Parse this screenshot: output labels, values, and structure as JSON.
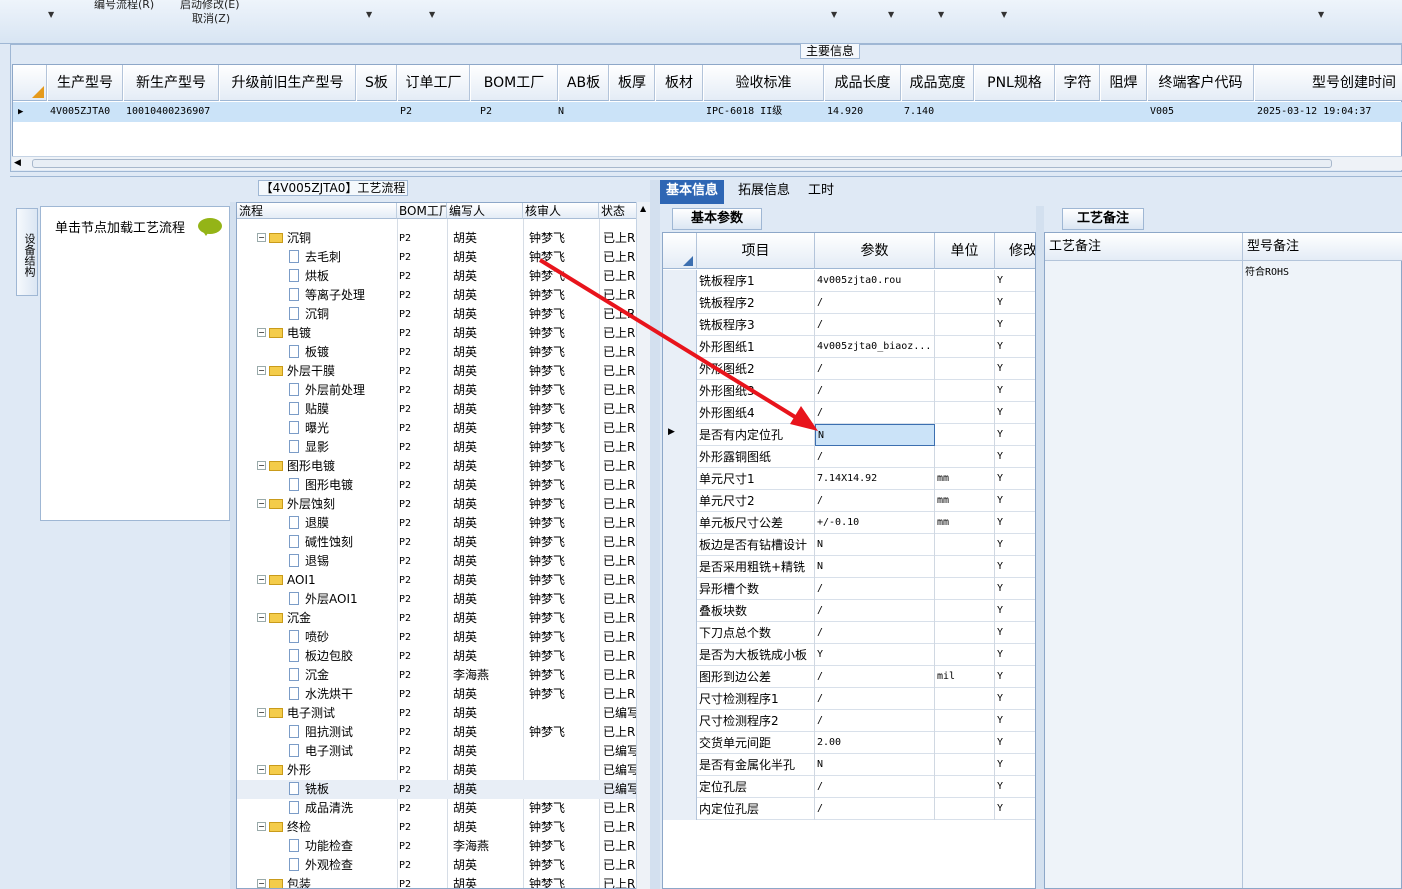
{
  "ribbon": {
    "items": [
      "编号流程(R)",
      "启动修改(E)",
      "取消(Z)"
    ]
  },
  "main_info": {
    "title": "主要信息",
    "columns": [
      "生产型号",
      "新生产型号",
      "升级前旧生产型号",
      "S板",
      "订单工厂",
      "BOM工厂",
      "AB板",
      "板厚",
      "板材",
      "验收标准",
      "成品长度",
      "成品宽度",
      "PNL规格",
      "字符",
      "阻焊",
      "终端客户代码",
      "型号创建时间"
    ],
    "row": [
      "4V005ZJTA0",
      "10010400236907",
      "",
      "",
      "P2",
      "P2",
      "N",
      "",
      "",
      "IPC-6018 II级",
      "14.920",
      "7.140",
      "",
      "",
      "",
      "V005",
      "2025-03-12 19:04:37"
    ]
  },
  "left_panel": {
    "side_tab": "设备结构",
    "load_label": "单击节点加载工艺流程"
  },
  "tree": {
    "title": "【4V005ZJTA0】工艺流程",
    "columns": [
      "流程",
      "BOM工厂",
      "编写人",
      "核审人",
      "状态"
    ],
    "rows": [
      {
        "name": "沉铜",
        "folder": true,
        "bom": "P2",
        "writer": "胡英",
        "reviewer": "钟梦飞",
        "status": "已上R"
      },
      {
        "name": "去毛刺",
        "folder": false,
        "bom": "P2",
        "writer": "胡英",
        "reviewer": "钟梦飞",
        "status": "已上R"
      },
      {
        "name": "烘板",
        "folder": false,
        "bom": "P2",
        "writer": "胡英",
        "reviewer": "钟梦飞",
        "status": "已上R"
      },
      {
        "name": "等离子处理",
        "folder": false,
        "bom": "P2",
        "writer": "胡英",
        "reviewer": "钟梦飞",
        "status": "已上R"
      },
      {
        "name": "沉铜",
        "folder": false,
        "bom": "P2",
        "writer": "胡英",
        "reviewer": "钟梦飞",
        "status": "已上R"
      },
      {
        "name": "电镀",
        "folder": true,
        "bom": "P2",
        "writer": "胡英",
        "reviewer": "钟梦飞",
        "status": "已上R"
      },
      {
        "name": "板镀",
        "folder": false,
        "bom": "P2",
        "writer": "胡英",
        "reviewer": "钟梦飞",
        "status": "已上R"
      },
      {
        "name": "外层干膜",
        "folder": true,
        "bom": "P2",
        "writer": "胡英",
        "reviewer": "钟梦飞",
        "status": "已上R"
      },
      {
        "name": "外层前处理",
        "folder": false,
        "bom": "P2",
        "writer": "胡英",
        "reviewer": "钟梦飞",
        "status": "已上R"
      },
      {
        "name": "贴膜",
        "folder": false,
        "bom": "P2",
        "writer": "胡英",
        "reviewer": "钟梦飞",
        "status": "已上R"
      },
      {
        "name": "曝光",
        "folder": false,
        "bom": "P2",
        "writer": "胡英",
        "reviewer": "钟梦飞",
        "status": "已上R"
      },
      {
        "name": "显影",
        "folder": false,
        "bom": "P2",
        "writer": "胡英",
        "reviewer": "钟梦飞",
        "status": "已上R"
      },
      {
        "name": "图形电镀",
        "folder": true,
        "bom": "P2",
        "writer": "胡英",
        "reviewer": "钟梦飞",
        "status": "已上R"
      },
      {
        "name": "图形电镀",
        "folder": false,
        "bom": "P2",
        "writer": "胡英",
        "reviewer": "钟梦飞",
        "status": "已上R"
      },
      {
        "name": "外层蚀刻",
        "folder": true,
        "bom": "P2",
        "writer": "胡英",
        "reviewer": "钟梦飞",
        "status": "已上R"
      },
      {
        "name": "退膜",
        "folder": false,
        "bom": "P2",
        "writer": "胡英",
        "reviewer": "钟梦飞",
        "status": "已上R"
      },
      {
        "name": "碱性蚀刻",
        "folder": false,
        "bom": "P2",
        "writer": "胡英",
        "reviewer": "钟梦飞",
        "status": "已上R"
      },
      {
        "name": "退锡",
        "folder": false,
        "bom": "P2",
        "writer": "胡英",
        "reviewer": "钟梦飞",
        "status": "已上R"
      },
      {
        "name": "AOI1",
        "folder": true,
        "bom": "P2",
        "writer": "胡英",
        "reviewer": "钟梦飞",
        "status": "已上R"
      },
      {
        "name": "外层AOI1",
        "folder": false,
        "bom": "P2",
        "writer": "胡英",
        "reviewer": "钟梦飞",
        "status": "已上R"
      },
      {
        "name": "沉金",
        "folder": true,
        "bom": "P2",
        "writer": "胡英",
        "reviewer": "钟梦飞",
        "status": "已上R"
      },
      {
        "name": "喷砂",
        "folder": false,
        "bom": "P2",
        "writer": "胡英",
        "reviewer": "钟梦飞",
        "status": "已上R"
      },
      {
        "name": "板边包胶",
        "folder": false,
        "bom": "P2",
        "writer": "胡英",
        "reviewer": "钟梦飞",
        "status": "已上R"
      },
      {
        "name": "沉金",
        "folder": false,
        "bom": "P2",
        "writer": "李海燕",
        "reviewer": "钟梦飞",
        "status": "已上R"
      },
      {
        "name": "水洗烘干",
        "folder": false,
        "bom": "P2",
        "writer": "胡英",
        "reviewer": "钟梦飞",
        "status": "已上R"
      },
      {
        "name": "电子测试",
        "folder": true,
        "bom": "P2",
        "writer": "胡英",
        "reviewer": "",
        "status": "已编写"
      },
      {
        "name": "阻抗测试",
        "folder": false,
        "bom": "P2",
        "writer": "胡英",
        "reviewer": "钟梦飞",
        "status": "已上R"
      },
      {
        "name": "电子测试",
        "folder": false,
        "bom": "P2",
        "writer": "胡英",
        "reviewer": "",
        "status": "已编写"
      },
      {
        "name": "外形",
        "folder": true,
        "bom": "P2",
        "writer": "胡英",
        "reviewer": "",
        "status": "已编写"
      },
      {
        "name": "铣板",
        "folder": false,
        "bom": "P2",
        "writer": "胡英",
        "reviewer": "",
        "status": "已编写"
      },
      {
        "name": "成品清洗",
        "folder": false,
        "bom": "P2",
        "writer": "胡英",
        "reviewer": "钟梦飞",
        "status": "已上R"
      },
      {
        "name": "终检",
        "folder": true,
        "bom": "P2",
        "writer": "胡英",
        "reviewer": "钟梦飞",
        "status": "已上R"
      },
      {
        "name": "功能检查",
        "folder": false,
        "bom": "P2",
        "writer": "李海燕",
        "reviewer": "钟梦飞",
        "status": "已上R"
      },
      {
        "name": "外观检查",
        "folder": false,
        "bom": "P2",
        "writer": "胡英",
        "reviewer": "钟梦飞",
        "status": "已上R"
      },
      {
        "name": "包装",
        "folder": true,
        "bom": "P2",
        "writer": "胡英",
        "reviewer": "钟梦飞",
        "status": "已上R"
      }
    ]
  },
  "right_tabs": [
    "基本信息",
    "拓展信息",
    "工时"
  ],
  "basic": {
    "tab": "基本参数",
    "columns": [
      "项目",
      "参数",
      "单位",
      "修改"
    ],
    "rows": [
      {
        "item": "铣板程序1",
        "value": "4v005zjta0.rou",
        "unit": "",
        "mod": "Y"
      },
      {
        "item": "铣板程序2",
        "value": "/",
        "unit": "",
        "mod": "Y"
      },
      {
        "item": "铣板程序3",
        "value": "/",
        "unit": "",
        "mod": "Y"
      },
      {
        "item": "外形图纸1",
        "value": "4v005zjta0_biaoz...",
        "unit": "",
        "mod": "Y"
      },
      {
        "item": "外形图纸2",
        "value": "/",
        "unit": "",
        "mod": "Y"
      },
      {
        "item": "外形图纸3",
        "value": "/",
        "unit": "",
        "mod": "Y"
      },
      {
        "item": "外形图纸4",
        "value": "/",
        "unit": "",
        "mod": "Y"
      },
      {
        "item": "是否有内定位孔",
        "value": "N",
        "unit": "",
        "mod": "Y"
      },
      {
        "item": "外形露铜图纸",
        "value": "/",
        "unit": "",
        "mod": "Y"
      },
      {
        "item": "单元尺寸1",
        "value": "7.14X14.92",
        "unit": "mm",
        "mod": "Y"
      },
      {
        "item": "单元尺寸2",
        "value": "/",
        "unit": "mm",
        "mod": "Y"
      },
      {
        "item": "单元板尺寸公差",
        "value": "+/-0.10",
        "unit": "mm",
        "mod": "Y"
      },
      {
        "item": "板边是否有钻槽设计",
        "value": "N",
        "unit": "",
        "mod": "Y"
      },
      {
        "item": "是否采用粗铣+精铣",
        "value": "N",
        "unit": "",
        "mod": "Y"
      },
      {
        "item": "异形槽个数",
        "value": "/",
        "unit": "",
        "mod": "Y"
      },
      {
        "item": "叠板块数",
        "value": "/",
        "unit": "",
        "mod": "Y"
      },
      {
        "item": "下刀点总个数",
        "value": "/",
        "unit": "",
        "mod": "Y"
      },
      {
        "item": "是否为大板铣成小板",
        "value": "Y",
        "unit": "",
        "mod": "Y"
      },
      {
        "item": "图形到边公差",
        "value": "/",
        "unit": "mil",
        "mod": "Y"
      },
      {
        "item": "尺寸检测程序1",
        "value": "/",
        "unit": "",
        "mod": "Y"
      },
      {
        "item": "尺寸检测程序2",
        "value": "/",
        "unit": "",
        "mod": "Y"
      },
      {
        "item": "交货单元间距",
        "value": "2.00",
        "unit": "",
        "mod": "Y"
      },
      {
        "item": "是否有金属化半孔",
        "value": "N",
        "unit": "",
        "mod": "Y"
      },
      {
        "item": "定位孔层",
        "value": "/",
        "unit": "",
        "mod": "Y"
      },
      {
        "item": "内定位孔层",
        "value": "/",
        "unit": "",
        "mod": "Y"
      }
    ]
  },
  "notes": {
    "tab": "工艺备注",
    "columns": [
      "工艺备注",
      "型号备注"
    ],
    "model_note": "符合ROHS"
  },
  "colors": {
    "accent": "#2e66b4",
    "selection": "#cbe3f8",
    "arrow": "#e8141c"
  }
}
